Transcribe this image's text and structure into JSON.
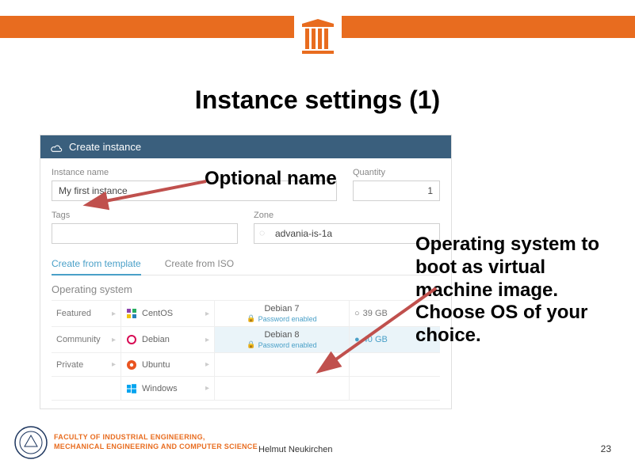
{
  "title": "Instance settings (1)",
  "annotations": {
    "optional_name": "Optional name",
    "os_choice": "Operating system to boot as virtual machine image. Choose OS of your choice."
  },
  "panel": {
    "header": "Create instance",
    "instance_name_label": "Instance name",
    "instance_name_value": "My first instance",
    "quantity_label": "Quantity",
    "quantity_value": "1",
    "tags_label": "Tags",
    "tags_value": "",
    "zone_label": "Zone",
    "zone_value": "advania-is-1a",
    "tabs": {
      "template": "Create from template",
      "iso": "Create from ISO"
    },
    "os_section": "Operating system",
    "categories": {
      "featured": "Featured",
      "community": "Community",
      "private": "Private"
    },
    "os": {
      "centos": {
        "name": "CentOS"
      },
      "debian": {
        "name": "Debian"
      },
      "ubuntu": {
        "name": "Ubuntu"
      },
      "windows": {
        "name": "Windows"
      }
    },
    "versions": {
      "deb7": {
        "name": "Debian 7",
        "sub": "Password enabled",
        "disk": "39 GB"
      },
      "deb8": {
        "name": "Debian 8",
        "sub": "Password enabled",
        "disk": "40 GB"
      }
    }
  },
  "footer": {
    "faculty_l1": "FACULTY OF INDUSTRIAL ENGINEERING,",
    "faculty_l2": "MECHANICAL ENGINEERING AND COMPUTER SCIENCE",
    "author": "Helmut Neukirchen",
    "page": "23"
  }
}
